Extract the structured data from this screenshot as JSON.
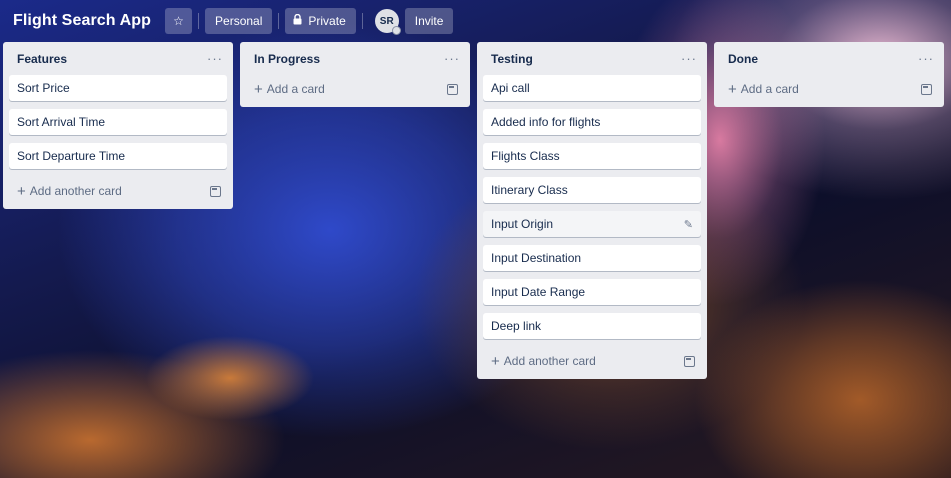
{
  "header": {
    "board_title": "Flight Search App",
    "star_icon": "☆",
    "personal_label": "Personal",
    "lock_icon": "🔒",
    "private_label": "Private",
    "avatar_initials": "SR",
    "invite_label": "Invite"
  },
  "lists": [
    {
      "title": "Features",
      "cards": [
        "Sort Price",
        "Sort Arrival Time",
        "Sort Departure Time"
      ],
      "add_label": "Add another card"
    },
    {
      "title": "In Progress",
      "cards": [],
      "add_label": "Add a card"
    },
    {
      "title": "Testing",
      "cards": [
        "Api call",
        "Added info for flights",
        "Flights Class",
        "Itinerary Class",
        "Input Origin",
        "Input Destination",
        "Input Date Range",
        "Deep link"
      ],
      "add_label": "Add another card"
    },
    {
      "title": "Done",
      "cards": [],
      "add_label": "Add a card"
    }
  ],
  "icons": {
    "menu": "···",
    "plus": "+",
    "pencil": "✎"
  },
  "colors": {
    "list_bg": "#ebecf0",
    "card_bg": "#ffffff",
    "text": "#172b4d",
    "muted": "#5e6c84"
  }
}
